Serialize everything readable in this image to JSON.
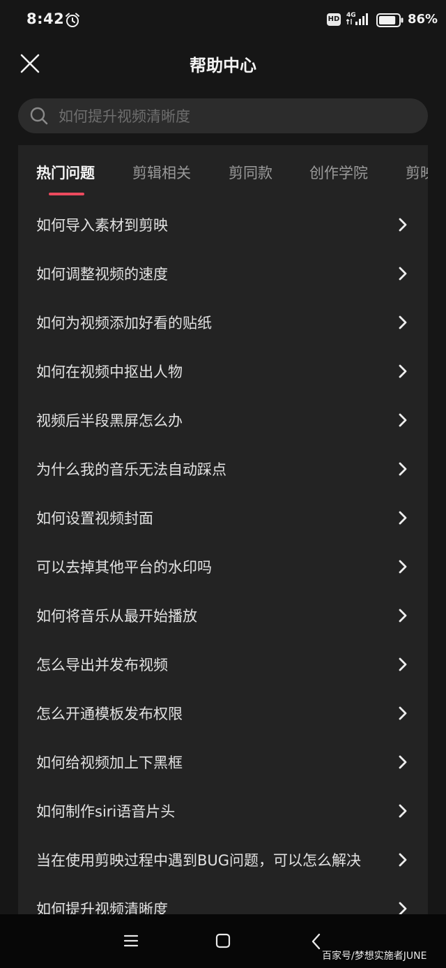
{
  "status_bar": {
    "time": "8:42",
    "alarm_icon": "alarm-clock-icon",
    "network_badge": "HD",
    "signal_icon": "signal-4g-icon",
    "battery_percent": "86%",
    "battery_level": 0.86
  },
  "header": {
    "close_icon": "close-icon",
    "title": "帮助中心"
  },
  "search": {
    "icon": "search-icon",
    "placeholder": "如何提升视频清晰度",
    "value": ""
  },
  "tabs": [
    {
      "label": "热门问题",
      "active": true
    },
    {
      "label": "剪辑相关",
      "active": false
    },
    {
      "label": "剪同款",
      "active": false
    },
    {
      "label": "创作学院",
      "active": false
    },
    {
      "label": "剪映",
      "active": false
    }
  ],
  "accent_color": "#ec4a5e",
  "faq": [
    "如何导入素材到剪映",
    "如何调整视频的速度",
    "如何为视频添加好看的贴纸",
    "如何在视频中抠出人物",
    "视频后半段黑屏怎么办",
    "为什么我的音乐无法自动踩点",
    "如何设置视频封面",
    "可以去掉其他平台的水印吗",
    "如何将音乐从最开始播放",
    "怎么导出并发布视频",
    "怎么开通模板发布权限",
    "如何给视频加上下黑框",
    "如何制作siri语音片头",
    "当在使用剪映过程中遇到BUG问题，可以怎么解决",
    "如何提升视频清晰度"
  ],
  "nav_bar": {
    "menu_icon": "menu-icon",
    "home_icon": "home-square-icon",
    "back_icon": "back-chevron-icon"
  },
  "watermark": "百家号/梦想实施者JUNE"
}
